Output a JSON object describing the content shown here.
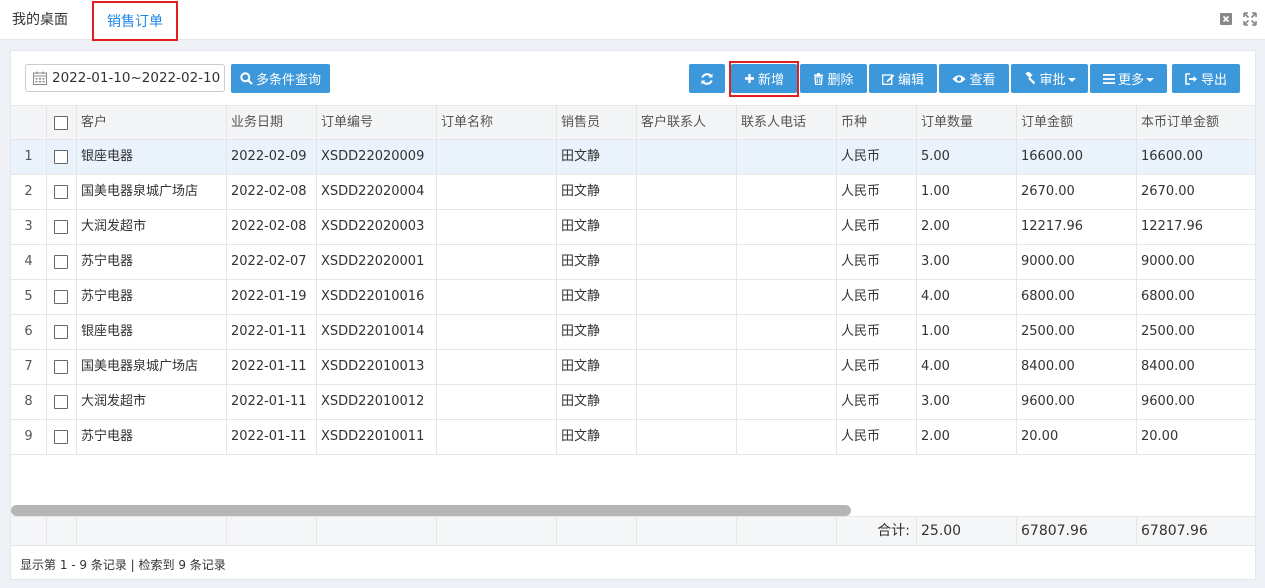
{
  "tabs": {
    "home": "我的桌面",
    "active": "销售订单"
  },
  "toolbar": {
    "date_range": "2022-01-10~2022-02-10",
    "query_label": "多条件查询",
    "add_label": "新增",
    "delete_label": "删除",
    "edit_label": "编辑",
    "view_label": "查看",
    "approve_label": "审批",
    "more_label": "更多",
    "export_label": "导出"
  },
  "table": {
    "columns": {
      "customer": "客户",
      "date": "业务日期",
      "order_no": "订单编号",
      "order_name": "订单名称",
      "salesperson": "销售员",
      "contact": "客户联系人",
      "phone": "联系人电话",
      "currency": "币种",
      "qty": "订单数量",
      "amount": "订单金额",
      "base_amount": "本币订单金额"
    },
    "rows": [
      {
        "idx": "1",
        "customer": "银座电器",
        "date": "2022-02-09",
        "order_no": "XSDD22020009",
        "order_name": "",
        "salesperson": "田文静",
        "contact": "",
        "phone": "",
        "currency": "人民币",
        "qty": "5.00",
        "amount": "16600.00",
        "base_amount": "16600.00"
      },
      {
        "idx": "2",
        "customer": "国美电器泉城广场店",
        "date": "2022-02-08",
        "order_no": "XSDD22020004",
        "order_name": "",
        "salesperson": "田文静",
        "contact": "",
        "phone": "",
        "currency": "人民币",
        "qty": "1.00",
        "amount": "2670.00",
        "base_amount": "2670.00"
      },
      {
        "idx": "3",
        "customer": "大润发超市",
        "date": "2022-02-08",
        "order_no": "XSDD22020003",
        "order_name": "",
        "salesperson": "田文静",
        "contact": "",
        "phone": "",
        "currency": "人民币",
        "qty": "2.00",
        "amount": "12217.96",
        "base_amount": "12217.96"
      },
      {
        "idx": "4",
        "customer": "苏宁电器",
        "date": "2022-02-07",
        "order_no": "XSDD22020001",
        "order_name": "",
        "salesperson": "田文静",
        "contact": "",
        "phone": "",
        "currency": "人民币",
        "qty": "3.00",
        "amount": "9000.00",
        "base_amount": "9000.00"
      },
      {
        "idx": "5",
        "customer": "苏宁电器",
        "date": "2022-01-19",
        "order_no": "XSDD22010016",
        "order_name": "",
        "salesperson": "田文静",
        "contact": "",
        "phone": "",
        "currency": "人民币",
        "qty": "4.00",
        "amount": "6800.00",
        "base_amount": "6800.00"
      },
      {
        "idx": "6",
        "customer": "银座电器",
        "date": "2022-01-11",
        "order_no": "XSDD22010014",
        "order_name": "",
        "salesperson": "田文静",
        "contact": "",
        "phone": "",
        "currency": "人民币",
        "qty": "1.00",
        "amount": "2500.00",
        "base_amount": "2500.00"
      },
      {
        "idx": "7",
        "customer": "国美电器泉城广场店",
        "date": "2022-01-11",
        "order_no": "XSDD22010013",
        "order_name": "",
        "salesperson": "田文静",
        "contact": "",
        "phone": "",
        "currency": "人民币",
        "qty": "4.00",
        "amount": "8400.00",
        "base_amount": "8400.00"
      },
      {
        "idx": "8",
        "customer": "大润发超市",
        "date": "2022-01-11",
        "order_no": "XSDD22010012",
        "order_name": "",
        "salesperson": "田文静",
        "contact": "",
        "phone": "",
        "currency": "人民币",
        "qty": "3.00",
        "amount": "9600.00",
        "base_amount": "9600.00"
      },
      {
        "idx": "9",
        "customer": "苏宁电器",
        "date": "2022-01-11",
        "order_no": "XSDD22010011",
        "order_name": "",
        "salesperson": "田文静",
        "contact": "",
        "phone": "",
        "currency": "人民币",
        "qty": "2.00",
        "amount": "20.00",
        "base_amount": "20.00"
      }
    ],
    "selected_row": 1
  },
  "totals": {
    "label": "合计:",
    "qty": "25.00",
    "amount": "67807.96",
    "base_amount": "67807.96"
  },
  "pager": {
    "text": "显示第 1 - 9 条记录 | 检索到 9 条记录"
  },
  "colors": {
    "primary": "#3c98db",
    "highlight": "#e02020",
    "active_tab_text": "#1e88e5",
    "selected_row": "#eaf2fc"
  },
  "icons": {
    "calendar": "calendar-icon",
    "search": "search-icon",
    "refresh": "refresh-icon",
    "add": "plus-icon",
    "delete": "trash-icon",
    "edit": "edit-icon",
    "view": "eye-icon",
    "approve": "gavel-icon",
    "more": "list-icon",
    "export": "export-icon",
    "close_window": "close-window-icon",
    "fullscreen": "fullscreen-icon"
  }
}
